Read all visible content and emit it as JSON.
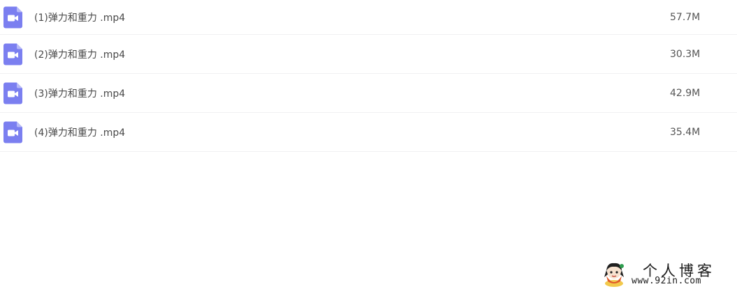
{
  "files": [
    {
      "name": "(1)弹力和重力 .mp4",
      "size": "57.7M",
      "icon": "video-file-icon"
    },
    {
      "name": "(2)弹力和重力 .mp4",
      "size": "30.3M",
      "icon": "video-file-icon"
    },
    {
      "name": "(3)弹力和重力 .mp4",
      "size": "42.9M",
      "icon": "video-file-icon"
    },
    {
      "name": "(4)弹力和重力 .mp4",
      "size": "35.4M",
      "icon": "video-file-icon"
    }
  ],
  "colors": {
    "icon_fill": "#7b7ff0",
    "icon_fold": "#b7baf7",
    "row_divider": "#f0f0f2",
    "text": "#4a4a4a"
  },
  "watermark": {
    "title": "个人博客",
    "url": "www.92in.com"
  }
}
